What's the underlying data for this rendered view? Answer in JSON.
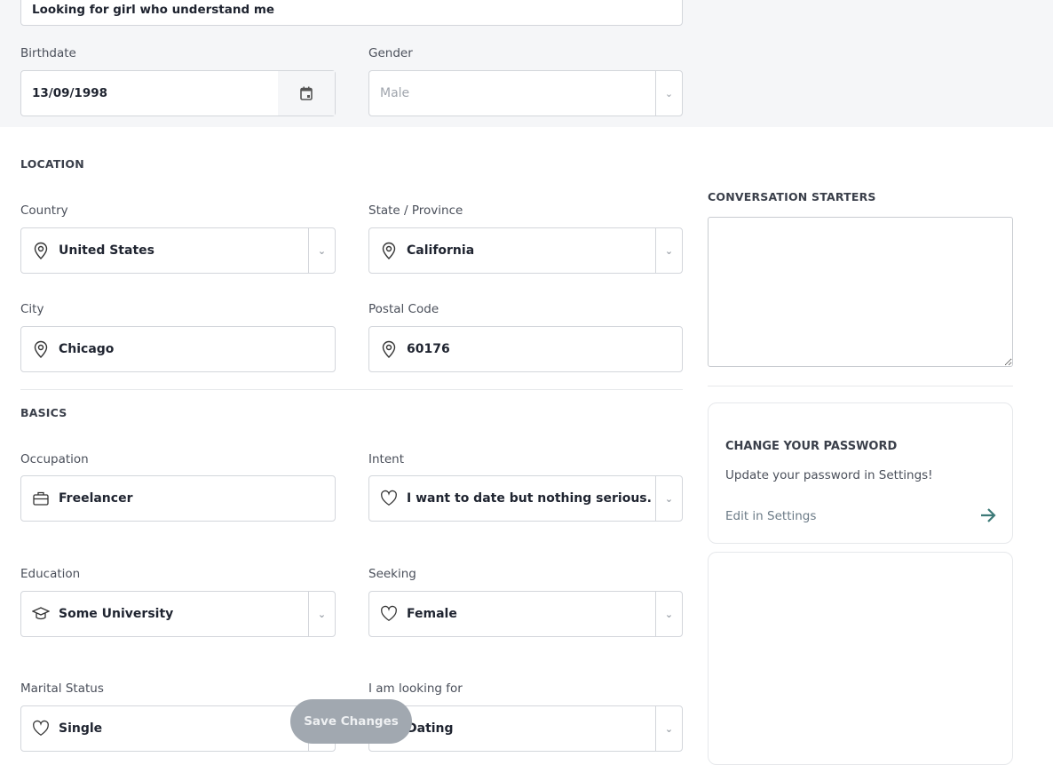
{
  "about": {
    "value": "Looking for girl  who understand me"
  },
  "birthdate": {
    "label": "Birthdate",
    "value": "13/09/1998",
    "icon": "calendar-icon"
  },
  "gender": {
    "label": "Gender",
    "value": "Male"
  },
  "location": {
    "title": "LOCATION",
    "fields": [
      {
        "label": "Country",
        "value": "United States",
        "icon": "map-pin-icon",
        "dropdown": true
      },
      {
        "label": "State / Province",
        "value": "California",
        "icon": "map-pin-icon",
        "dropdown": true
      },
      {
        "label": "City",
        "value": "Chicago",
        "icon": "map-pin-icon",
        "dropdown": false
      },
      {
        "label": "Postal Code",
        "value": "60176",
        "icon": "map-pin-icon",
        "dropdown": false
      }
    ]
  },
  "basics": {
    "title": "BASICS",
    "fields": [
      {
        "label": "Occupation",
        "value": "Freelancer",
        "icon": "briefcase-icon",
        "dropdown": false
      },
      {
        "label": "Intent",
        "value": "I want to date but nothing serious.",
        "icon": "heart-icon",
        "dropdown": true
      },
      {
        "label": "Education",
        "value": "Some University",
        "icon": "graduation-cap-icon",
        "dropdown": true
      },
      {
        "label": "Seeking",
        "value": "Female",
        "icon": "heart-icon",
        "dropdown": true
      },
      {
        "label": "Marital Status",
        "value": "Single",
        "icon": "heart-icon",
        "dropdown": true
      },
      {
        "label": "I am looking for",
        "value": "Dating",
        "icon": "heart-icon",
        "dropdown": true
      }
    ]
  },
  "conversation_starters": {
    "title": "CONVERSATION STARTERS",
    "value": ""
  },
  "password_card": {
    "title": "CHANGE YOUR PASSWORD",
    "text": "Update your password in Settings!",
    "link": "Edit in Settings",
    "accent": "#3d7a78"
  },
  "save_button": {
    "label": "Save Changes"
  }
}
